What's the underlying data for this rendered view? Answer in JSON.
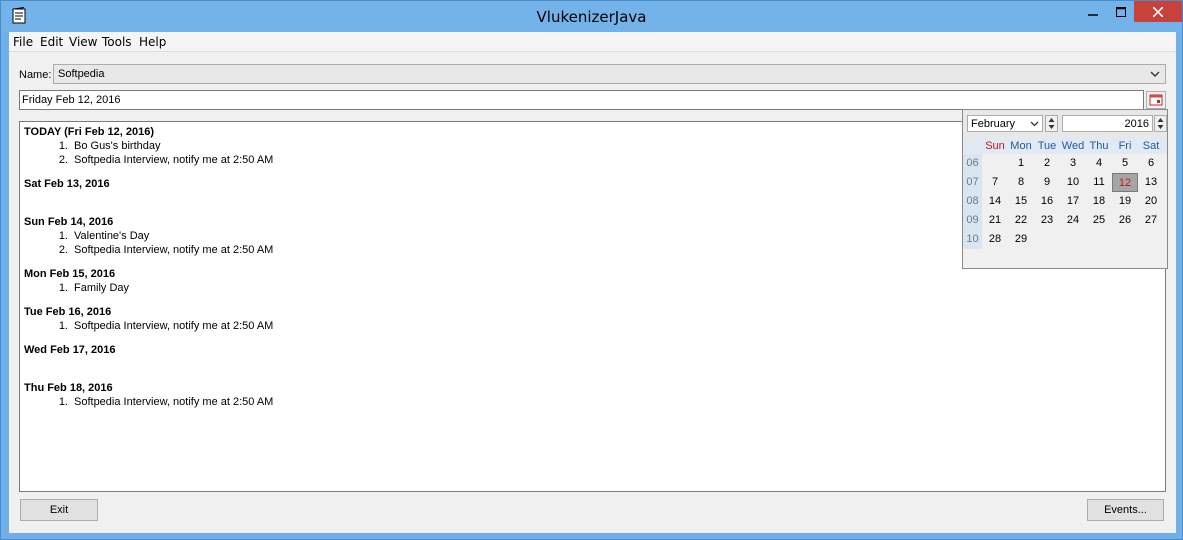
{
  "window": {
    "title": "VlukenizerJava"
  },
  "menu": [
    "File",
    "Edit",
    "View",
    "Tools",
    "Help"
  ],
  "name_row": {
    "label": "Name:",
    "value": "Softpedia"
  },
  "date_field": {
    "value": "Friday Feb 12, 2016"
  },
  "days": [
    {
      "title": "TODAY (Fri Feb 12, 2016)",
      "events": [
        "Bo Gus's birthday",
        "Softpedia Interview, notify me at 2:50 AM"
      ]
    },
    {
      "title": "Sat Feb 13, 2016",
      "events": []
    },
    {
      "title": "Sun Feb 14, 2016",
      "events": [
        "Valentine's Day",
        "Softpedia Interview, notify me at 2:50 AM"
      ]
    },
    {
      "title": "Mon Feb 15, 2016",
      "events": [
        "Family Day"
      ]
    },
    {
      "title": "Tue Feb 16, 2016",
      "events": [
        "Softpedia Interview, notify me at 2:50 AM"
      ]
    },
    {
      "title": "Wed Feb 17, 2016",
      "events": []
    },
    {
      "title": "Thu Feb 18, 2016",
      "events": [
        "Softpedia Interview, notify me at 2:50 AM"
      ]
    }
  ],
  "calendar": {
    "month": "February",
    "year": "2016",
    "weekdays": [
      "Sun",
      "Mon",
      "Tue",
      "Wed",
      "Thu",
      "Fri",
      "Sat"
    ],
    "weeks": [
      {
        "num": "06",
        "days": [
          "",
          "1",
          "2",
          "3",
          "4",
          "5",
          "6"
        ]
      },
      {
        "num": "07",
        "days": [
          "7",
          "8",
          "9",
          "10",
          "11",
          "12",
          "13"
        ]
      },
      {
        "num": "08",
        "days": [
          "14",
          "15",
          "16",
          "17",
          "18",
          "19",
          "20"
        ]
      },
      {
        "num": "09",
        "days": [
          "21",
          "22",
          "23",
          "24",
          "25",
          "26",
          "27"
        ]
      },
      {
        "num": "10",
        "days": [
          "28",
          "29",
          "",
          "",
          "",
          "",
          ""
        ]
      }
    ],
    "selected_day": "12"
  },
  "buttons": {
    "exit": "Exit",
    "events": "Events..."
  },
  "icons": {
    "app": "notepad-icon",
    "minimize": "minimize-icon",
    "maximize": "maximize-icon",
    "close": "close-icon",
    "dropdown": "chevron-down-icon",
    "calendar": "calendar-icon"
  },
  "colors": {
    "titlebar": "#74b3ea",
    "close": "#c7423a",
    "selected_day": "#a5a5a5",
    "sunday": "#c01818",
    "weekday_header": "#1e5a9c"
  }
}
